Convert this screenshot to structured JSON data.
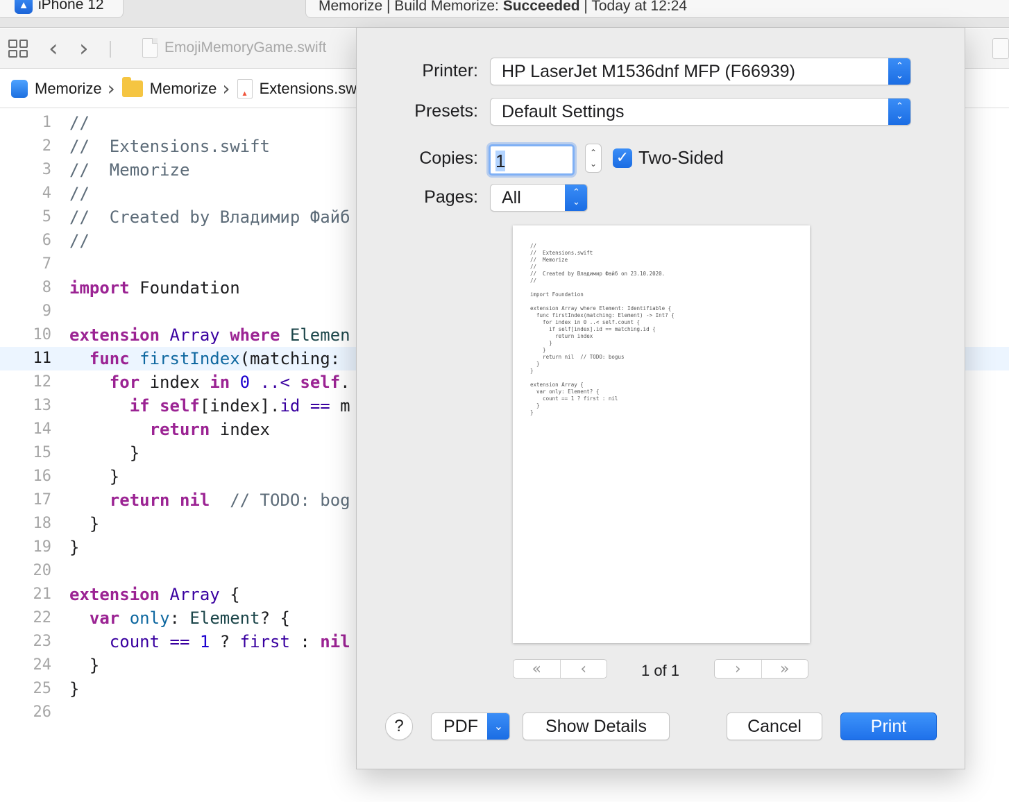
{
  "window": {
    "scheme_device": "iPhone 12",
    "activity_prefix": "Memorize | Build Memorize: ",
    "activity_status": "Succeeded",
    "activity_suffix": " | Today at 12:24"
  },
  "navbar": {
    "back_glyph": "‹",
    "forward_glyph": "›",
    "file_tab": "EmojiMemoryGame.swift"
  },
  "jumpbar": {
    "items": [
      {
        "label": "Memorize",
        "icon": "app-icon"
      },
      {
        "label": "Memorize",
        "icon": "folder-icon"
      },
      {
        "label": "Extensions.swift",
        "icon": "swift-file-icon"
      }
    ]
  },
  "editor": {
    "current_line": 11,
    "lines": [
      {
        "n": "1",
        "tokens": [
          {
            "t": "//",
            "c": "comment"
          }
        ]
      },
      {
        "n": "2",
        "tokens": [
          {
            "t": "//  Extensions.swift",
            "c": "comment"
          }
        ]
      },
      {
        "n": "3",
        "tokens": [
          {
            "t": "//  Memorize",
            "c": "comment"
          }
        ]
      },
      {
        "n": "4",
        "tokens": [
          {
            "t": "//",
            "c": "comment"
          }
        ]
      },
      {
        "n": "5",
        "tokens": [
          {
            "t": "//  Created by Владимир Файб",
            "c": "comment"
          }
        ]
      },
      {
        "n": "6",
        "tokens": [
          {
            "t": "//",
            "c": "comment"
          }
        ]
      },
      {
        "n": "7",
        "tokens": []
      },
      {
        "n": "8",
        "tokens": [
          {
            "t": "import",
            "c": "kw"
          },
          {
            "t": " Foundation",
            "c": ""
          }
        ]
      },
      {
        "n": "9",
        "tokens": []
      },
      {
        "n": "10",
        "tokens": [
          {
            "t": "extension",
            "c": "kw"
          },
          {
            "t": " ",
            "c": ""
          },
          {
            "t": "Array",
            "c": "type"
          },
          {
            "t": " ",
            "c": ""
          },
          {
            "t": "where",
            "c": "kw"
          },
          {
            "t": " Elemen",
            "c": "typename"
          }
        ]
      },
      {
        "n": "11",
        "tokens": [
          {
            "t": "  ",
            "c": ""
          },
          {
            "t": "func",
            "c": "kw"
          },
          {
            "t": " ",
            "c": ""
          },
          {
            "t": "firstIndex",
            "c": "func"
          },
          {
            "t": "(matching: ",
            "c": ""
          }
        ]
      },
      {
        "n": "12",
        "tokens": [
          {
            "t": "    ",
            "c": ""
          },
          {
            "t": "for",
            "c": "kw"
          },
          {
            "t": " index ",
            "c": ""
          },
          {
            "t": "in",
            "c": "kw"
          },
          {
            "t": " ",
            "c": ""
          },
          {
            "t": "0",
            "c": "num"
          },
          {
            "t": " ..< ",
            "c": "type"
          },
          {
            "t": "self",
            "c": "kw"
          },
          {
            "t": ".",
            "c": ""
          }
        ]
      },
      {
        "n": "13",
        "tokens": [
          {
            "t": "      ",
            "c": ""
          },
          {
            "t": "if",
            "c": "kw"
          },
          {
            "t": " ",
            "c": ""
          },
          {
            "t": "self",
            "c": "kw"
          },
          {
            "t": "[index].",
            "c": ""
          },
          {
            "t": "id",
            "c": "type"
          },
          {
            "t": " ",
            "c": ""
          },
          {
            "t": "==",
            "c": "type"
          },
          {
            "t": " m",
            "c": ""
          }
        ]
      },
      {
        "n": "14",
        "tokens": [
          {
            "t": "        ",
            "c": ""
          },
          {
            "t": "return",
            "c": "kw"
          },
          {
            "t": " index",
            "c": ""
          }
        ]
      },
      {
        "n": "15",
        "tokens": [
          {
            "t": "      }",
            "c": ""
          }
        ]
      },
      {
        "n": "16",
        "tokens": [
          {
            "t": "    }",
            "c": ""
          }
        ]
      },
      {
        "n": "17",
        "tokens": [
          {
            "t": "    ",
            "c": ""
          },
          {
            "t": "return",
            "c": "kw"
          },
          {
            "t": " ",
            "c": ""
          },
          {
            "t": "nil",
            "c": "kw"
          },
          {
            "t": "  // TODO: bog",
            "c": "comment"
          }
        ]
      },
      {
        "n": "18",
        "tokens": [
          {
            "t": "  }",
            "c": ""
          }
        ]
      },
      {
        "n": "19",
        "tokens": [
          {
            "t": "}",
            "c": ""
          }
        ]
      },
      {
        "n": "20",
        "tokens": []
      },
      {
        "n": "21",
        "tokens": [
          {
            "t": "extension",
            "c": "kw"
          },
          {
            "t": " ",
            "c": ""
          },
          {
            "t": "Array",
            "c": "type"
          },
          {
            "t": " {",
            "c": ""
          }
        ]
      },
      {
        "n": "22",
        "tokens": [
          {
            "t": "  ",
            "c": ""
          },
          {
            "t": "var",
            "c": "kw"
          },
          {
            "t": " ",
            "c": ""
          },
          {
            "t": "only",
            "c": "func"
          },
          {
            "t": ": ",
            "c": ""
          },
          {
            "t": "Element",
            "c": "typename"
          },
          {
            "t": "? {",
            "c": ""
          }
        ]
      },
      {
        "n": "23",
        "tokens": [
          {
            "t": "    ",
            "c": ""
          },
          {
            "t": "count",
            "c": "type"
          },
          {
            "t": " ",
            "c": ""
          },
          {
            "t": "==",
            "c": "type"
          },
          {
            "t": " ",
            "c": ""
          },
          {
            "t": "1",
            "c": "num"
          },
          {
            "t": " ? ",
            "c": ""
          },
          {
            "t": "first",
            "c": "type"
          },
          {
            "t": " : ",
            "c": ""
          },
          {
            "t": "nil",
            "c": "kw"
          }
        ]
      },
      {
        "n": "24",
        "tokens": [
          {
            "t": "  }",
            "c": ""
          }
        ]
      },
      {
        "n": "25",
        "tokens": [
          {
            "t": "}",
            "c": ""
          }
        ]
      },
      {
        "n": "26",
        "tokens": []
      }
    ]
  },
  "print_dialog": {
    "printer_label": "Printer:",
    "printer_value": "HP LaserJet M1536dnf MFP (F66939)",
    "presets_label": "Presets:",
    "presets_value": "Default Settings",
    "copies_label": "Copies:",
    "copies_value": "1",
    "two_sided_label": "Two-Sided",
    "two_sided_checked": true,
    "pages_label": "Pages:",
    "pages_value": "All",
    "preview_text": "//\n//  Extensions.swift\n//  Memorize\n//\n//  Created by Владимир Файб on 23.10.2020.\n//\n\nimport Foundation\n\nextension Array where Element: Identifiable {\n  func firstIndex(matching: Element) -> Int? {\n    for index in 0 ..< self.count {\n      if self[index].id == matching.id {\n        return index\n      }\n    }\n    return nil  // TODO: bogus\n  }\n}\n\nextension Array {\n  var only: Element? {\n    count == 1 ? first : nil\n  }\n}",
    "pager": {
      "first": "«",
      "prev": "‹",
      "next": "›",
      "last": "»",
      "indicator": "1 of 1"
    },
    "help_label": "?",
    "pdf_label": "PDF",
    "show_details_label": "Show Details",
    "cancel_label": "Cancel",
    "print_label": "Print"
  },
  "colors": {
    "accent": "#1f71ea",
    "keyword": "#9b2393",
    "comment": "#5d6c79",
    "current_line_bg": "#ecf5ff"
  }
}
